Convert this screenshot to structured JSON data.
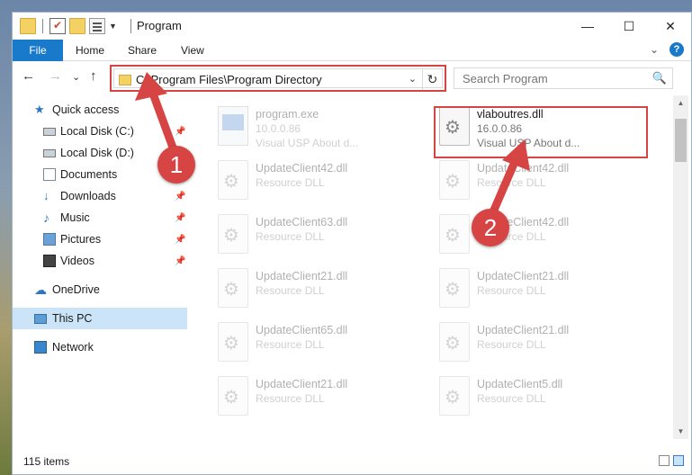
{
  "window": {
    "title": "Program",
    "controls": {
      "minimize": "—",
      "maximize": "☐",
      "close": "✕"
    }
  },
  "ribbon": {
    "tabs": [
      "File",
      "Home",
      "Share",
      "View"
    ],
    "expand_glyph": "⌄",
    "help_glyph": "?"
  },
  "nav": {
    "back": "←",
    "forward": "→",
    "recent": "⌄",
    "up": "↑",
    "address": "C:\\Program Files\\Program Directory",
    "address_dropdown": "⌄",
    "refresh": "↻",
    "search_placeholder": "Search Program",
    "search_icon": "🔍"
  },
  "sidebar": {
    "items": [
      {
        "label": "Quick access",
        "icon": "star-icon",
        "pinned": false
      },
      {
        "label": "Local Disk (C:)",
        "icon": "disk-icon",
        "pinned": true
      },
      {
        "label": "Local Disk (D:)",
        "icon": "disk-icon",
        "pinned": false
      },
      {
        "label": "Documents",
        "icon": "documents-icon",
        "pinned": false
      },
      {
        "label": "Downloads",
        "icon": "download-icon",
        "pinned": true
      },
      {
        "label": "Music",
        "icon": "music-icon",
        "pinned": true
      },
      {
        "label": "Pictures",
        "icon": "pictures-icon",
        "pinned": true
      },
      {
        "label": "Videos",
        "icon": "videos-icon",
        "pinned": true
      },
      {
        "label": "OneDrive",
        "icon": "cloud-icon",
        "pinned": false
      },
      {
        "label": "This PC",
        "icon": "computer-icon",
        "pinned": false,
        "selected": true
      },
      {
        "label": "Network",
        "icon": "network-icon",
        "pinned": false
      }
    ],
    "pin_glyph": "📌"
  },
  "files": [
    {
      "name": "program.exe",
      "line1": "10.0.0.86",
      "line2": "Visual USP About d...",
      "type": "exe",
      "faded": true
    },
    {
      "name": "vlaboutres.dll",
      "line1": "16.0.0.86",
      "line2": "Visual USP About d...",
      "type": "dll",
      "faded": false,
      "highlighted": true
    },
    {
      "name": "UpdateClient42.dll",
      "line1": "Resource DLL",
      "type": "dll",
      "faded": true
    },
    {
      "name": "UpdateClient42.dll",
      "line1": "Resource DLL",
      "type": "dll",
      "faded": true
    },
    {
      "name": "UpdateClient63.dll",
      "line1": "Resource DLL",
      "type": "dll",
      "faded": true
    },
    {
      "name": "UpdateClient42.dll",
      "line1": "Resource DLL",
      "type": "dll",
      "faded": true
    },
    {
      "name": "UpdateClient21.dll",
      "line1": "Resource DLL",
      "type": "dll",
      "faded": true
    },
    {
      "name": "UpdateClient21.dll",
      "line1": "Resource DLL",
      "type": "dll",
      "faded": true
    },
    {
      "name": "UpdateClient65.dll",
      "line1": "Resource DLL",
      "type": "dll",
      "faded": true
    },
    {
      "name": "UpdateClient21.dll",
      "line1": "Resource DLL",
      "type": "dll",
      "faded": true
    },
    {
      "name": "UpdateClient21.dll",
      "line1": "Resource DLL",
      "type": "dll",
      "faded": true
    },
    {
      "name": "UpdateClient5.dll",
      "line1": "Resource DLL",
      "type": "dll",
      "faded": true
    }
  ],
  "status": {
    "count": "115 items"
  },
  "annotations": {
    "step1": "1",
    "step2": "2",
    "color": "#d64544"
  }
}
